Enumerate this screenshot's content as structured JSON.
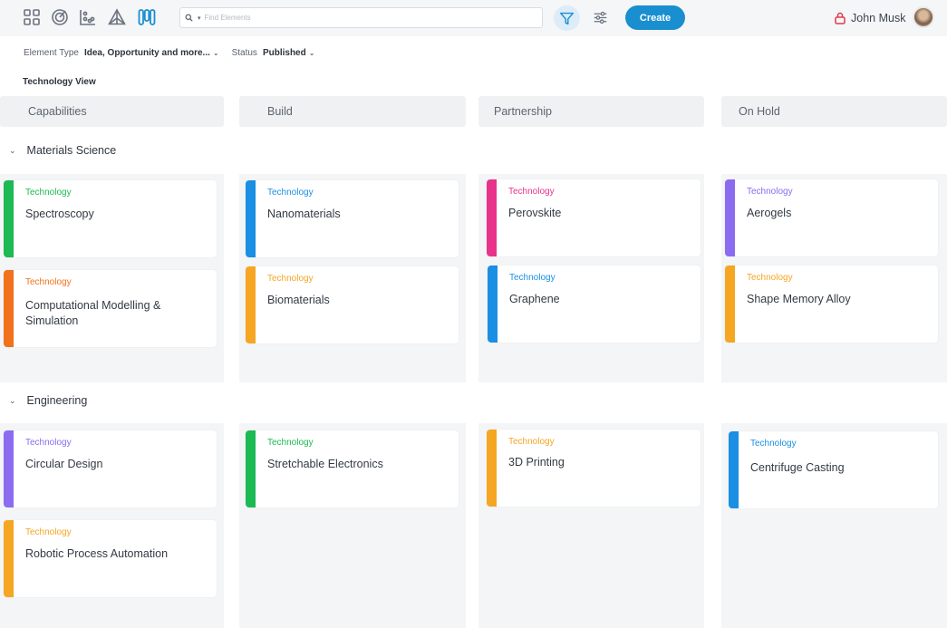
{
  "toolbar": {
    "nav_icons": [
      "grid-icon",
      "target-icon",
      "chart-icon",
      "triangle-icon",
      "kanban-icon"
    ],
    "search_placeholder": "Find Elements",
    "create_label": "Create",
    "user_name": "John Musk",
    "accent": "#1a8fd0"
  },
  "filters": {
    "element_type_label": "Element Type",
    "element_type_value": "Idea, Opportunity and more...",
    "status_label": "Status",
    "status_value": "Published"
  },
  "view_title": "Technology View",
  "columns": [
    "Capabilities",
    "Build",
    "Partnership",
    "On Hold"
  ],
  "groups": [
    {
      "name": "Materials Science",
      "cards": [
        {
          "tag": "Technology",
          "title": "Spectroscopy",
          "color": "#1db954"
        },
        {
          "tag": "Technology",
          "title": "Computational Modelling & Simulation",
          "color": "#f2711c"
        },
        {
          "tag": "Technology",
          "title": "Nanomaterials",
          "color": "#1a8fe3"
        },
        {
          "tag": "Technology",
          "title": "Biomaterials",
          "color": "#f5a623"
        },
        {
          "tag": "Technology",
          "title": "Perovskite",
          "color": "#e8338b"
        },
        {
          "tag": "Technology",
          "title": "Graphene",
          "color": "#1a8fe3"
        },
        {
          "tag": "Technology",
          "title": "Aerogels",
          "color": "#8b6cf0"
        },
        {
          "tag": "Technology",
          "title": "Shape Memory Alloy",
          "color": "#f5a623"
        }
      ]
    },
    {
      "name": "Engineering",
      "cards": [
        {
          "tag": "Technology",
          "title": "Circular Design",
          "color": "#8b6cf0"
        },
        {
          "tag": "Technology",
          "title": "Robotic Process Automation",
          "color": "#f5a623"
        },
        {
          "tag": "Technology",
          "title": "Stretchable Electronics",
          "color": "#1db954"
        },
        {
          "tag": "Technology",
          "title": "3D Printing",
          "color": "#f5a623"
        },
        {
          "tag": "Technology",
          "title": "Centrifuge Casting",
          "color": "#1a8fe3"
        }
      ]
    }
  ]
}
